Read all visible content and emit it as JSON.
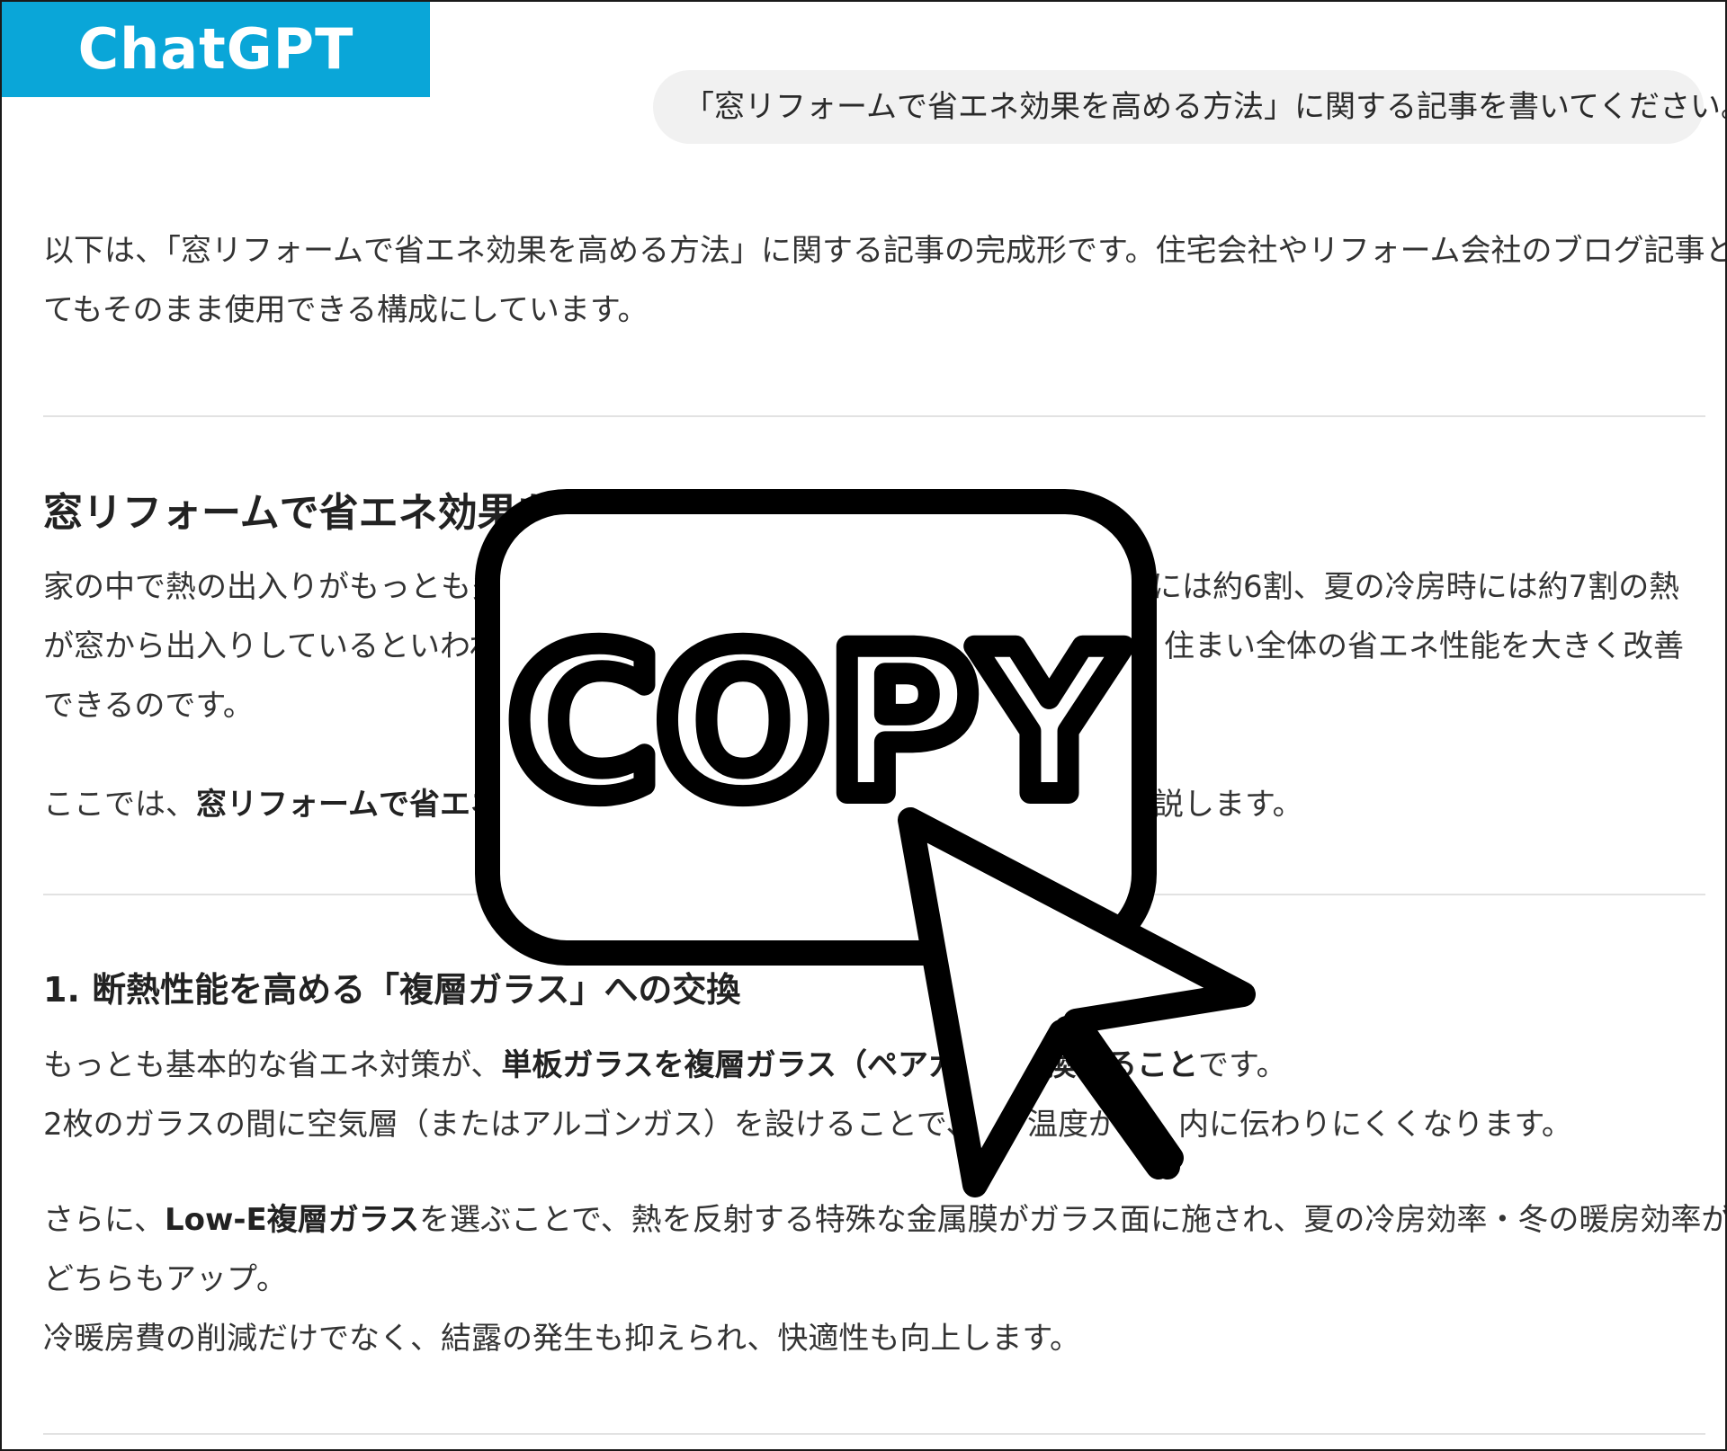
{
  "app": {
    "brand_label": "ChatGPT"
  },
  "user_message": "「窓リフォームで省エネ効果を高める方法」に関する記事を書いてください。",
  "response": {
    "intro_line1": "以下は、「窓リフォームで省エネ効果を高める方法」に関する記事の完成形です。住宅会社やリフォーム会社のブログ記事とし",
    "intro_line2": "てもそのまま使用できる構成にしています。",
    "heading_visible": "窓リフォームで省エネ効果を",
    "section1_para1_line1_left": "家の中で熱の出入りがもっとも多",
    "section1_para1_line1_right": "には約6割、夏の冷房時には約7割の熱",
    "section1_para1_line2_left": "が窓から出入りしているといわれ",
    "section1_para1_line2_right": "住まい全体の省エネ性能を大きく改善",
    "section1_para1_line3": "できるのです。",
    "section1_para2_prefix": "ここでは、",
    "section1_para2_bold": "窓リフォームで省エネ効",
    "section1_para2_suffix": "説します。",
    "subheading_1": "1. 断熱性能を高める「複層ガラス」への交換",
    "sub1_line1_prefix": "もっとも基本的な省エネ対策が、",
    "sub1_line1_bold": "単板ガラスを複層ガラス（ペアガラ",
    "sub1_line1_bold2": "換すること",
    "sub1_line1_suffix": "です。",
    "sub1_line2_left": "2枚のガラスの間に空気層（またはアルゴンガス）を設けることで、外",
    "sub1_line2_mid": "温度が",
    "sub1_line2_right": "内に伝わりにくくなります。",
    "sub1_para2_prefix": "さらに、",
    "sub1_para2_bold": "Low-E複層ガラス",
    "sub1_para2_line1_rest": "を選ぶことで、熱を反射する特殊な金属膜がガラス面に施され、夏の冷房効率・冬の暖房効率が",
    "sub1_para2_line2": "どちらもアップ。",
    "sub1_para2_line3": "冷暖房費の削減だけでなく、結露の発生も抑えられ、快適性も向上します。"
  },
  "overlay": {
    "copy_label": "COPY",
    "icon": "copy-button-cursor-icon"
  },
  "colors": {
    "brand": "#0aa6d8",
    "bubble": "#f1f1f1",
    "text": "#333333",
    "divider": "#e2e2e2",
    "overlay_stroke": "#000000"
  }
}
